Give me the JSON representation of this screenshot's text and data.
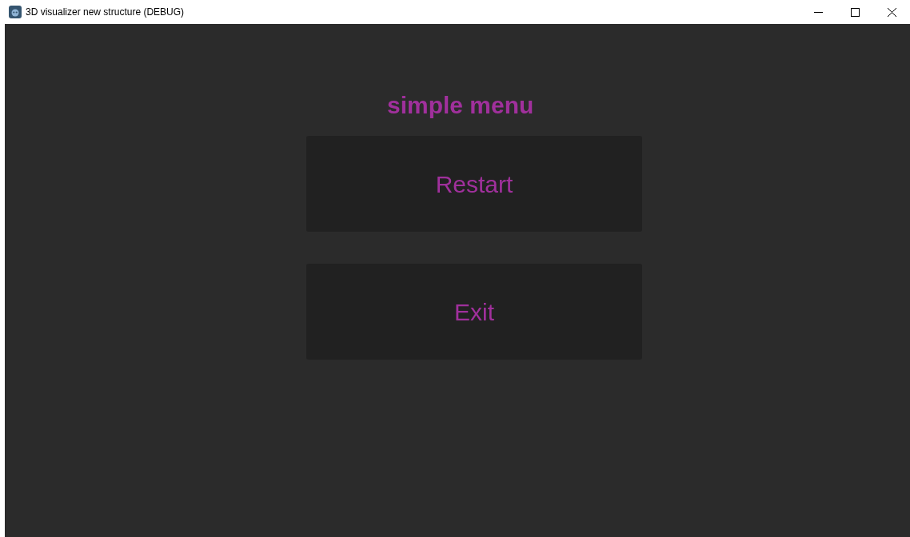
{
  "window": {
    "title": "3D visualizer new structure (DEBUG)"
  },
  "menu": {
    "title": "simple menu",
    "buttons": [
      {
        "label": "Restart"
      },
      {
        "label": "Exit"
      }
    ]
  }
}
